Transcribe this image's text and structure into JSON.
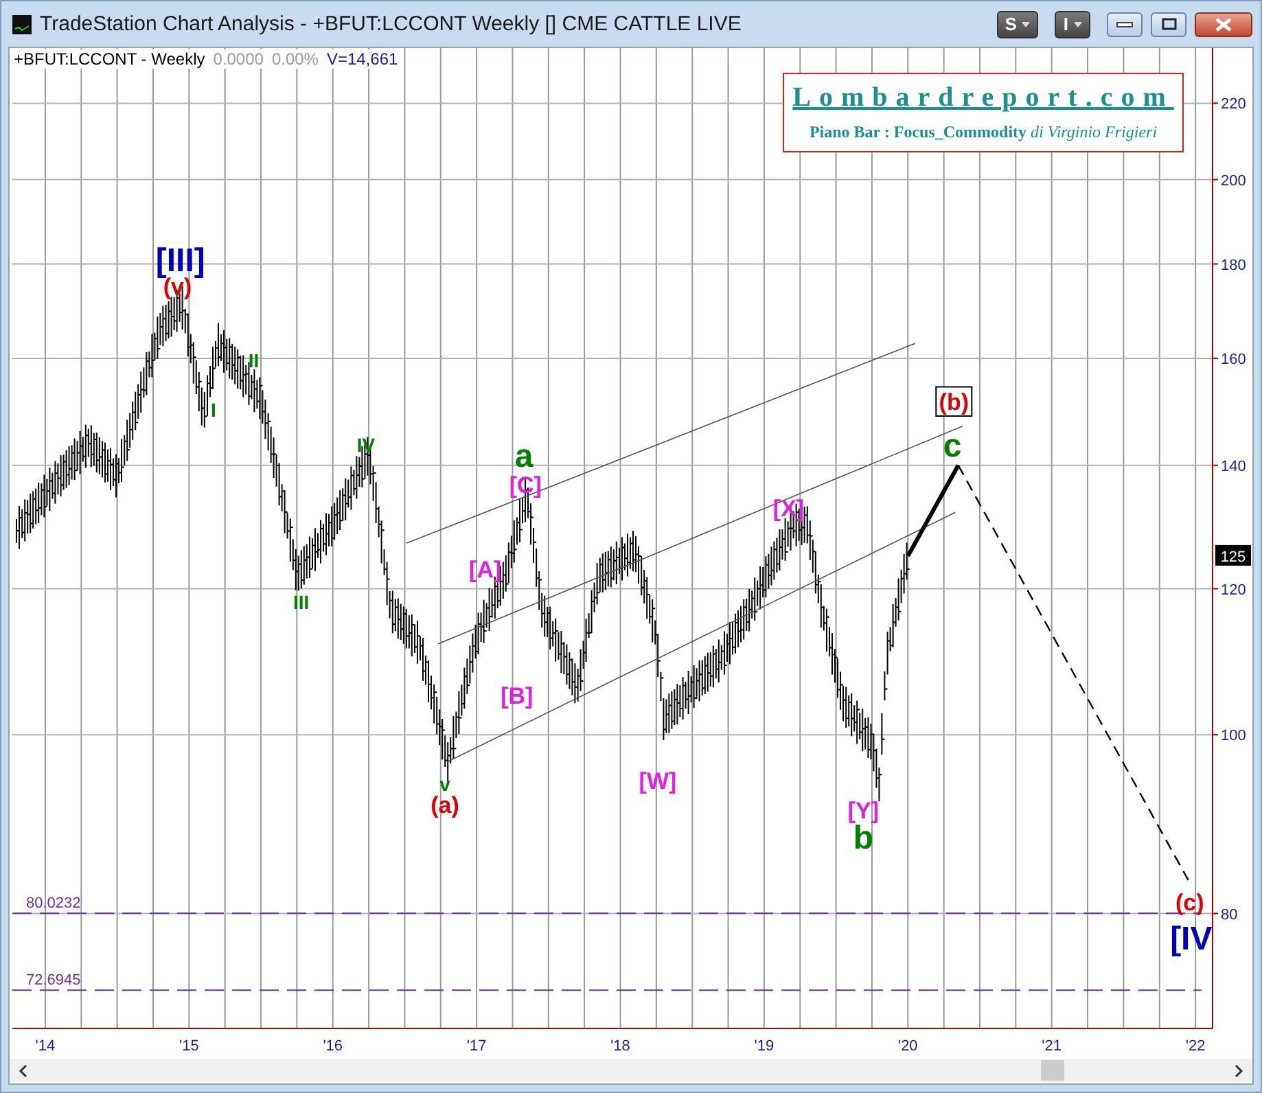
{
  "window": {
    "title": "TradeStation Chart Analysis - +BFUT:LCCONT Weekly [] CME CATTLE LIVE",
    "toolbar_buttons": [
      "S",
      "I"
    ]
  },
  "header": {
    "symbol": "+BFUT:LCCONT - Weekly",
    "change": "0.0000",
    "percent": "0.00%",
    "volume": "V=14,661"
  },
  "logo": {
    "site": "Lombardreport.com",
    "subtitle": "**Piano Bar : Focus_Commodity** *di Virginio Frigieri*"
  },
  "chart": {
    "price_axis": [
      "220",
      "200",
      "180",
      "160",
      "140",
      "120",
      "100",
      "80"
    ],
    "time_axis": [
      "'14",
      "'15",
      "'16",
      "'17",
      "'18",
      "'19",
      "'20",
      "'21",
      "'22"
    ],
    "level_labels": [
      "80.0232",
      "72.6945"
    ],
    "last_price": "125",
    "wave_labels": [
      {
        "text": "[III]",
        "color": "#0000c0"
      },
      {
        "text": "(v)",
        "color": "#e00000"
      },
      {
        "text": "I",
        "color": "#008000"
      },
      {
        "text": "II",
        "color": "#008000"
      },
      {
        "text": "III",
        "color": "#008000"
      },
      {
        "text": "IV",
        "color": "#008000"
      },
      {
        "text": "v",
        "color": "#008000"
      },
      {
        "text": "(a)",
        "color": "#e00000"
      },
      {
        "text": "a",
        "color": "#008000"
      },
      {
        "text": "[C]",
        "color": "#e020e0"
      },
      {
        "text": "[A]",
        "color": "#e020e0"
      },
      {
        "text": "[B]",
        "color": "#e020e0"
      },
      {
        "text": "[W]",
        "color": "#e020e0"
      },
      {
        "text": "[X]",
        "color": "#e020e0"
      },
      {
        "text": "[Y]",
        "color": "#e020e0"
      },
      {
        "text": "b",
        "color": "#008000"
      },
      {
        "text": "(b)",
        "color": "#e00000"
      },
      {
        "text": "c",
        "color": "#008000"
      },
      {
        "text": "(c)",
        "color": "#e00000"
      },
      {
        "text": "[IV",
        "color": "#0000c0"
      }
    ]
  }
}
